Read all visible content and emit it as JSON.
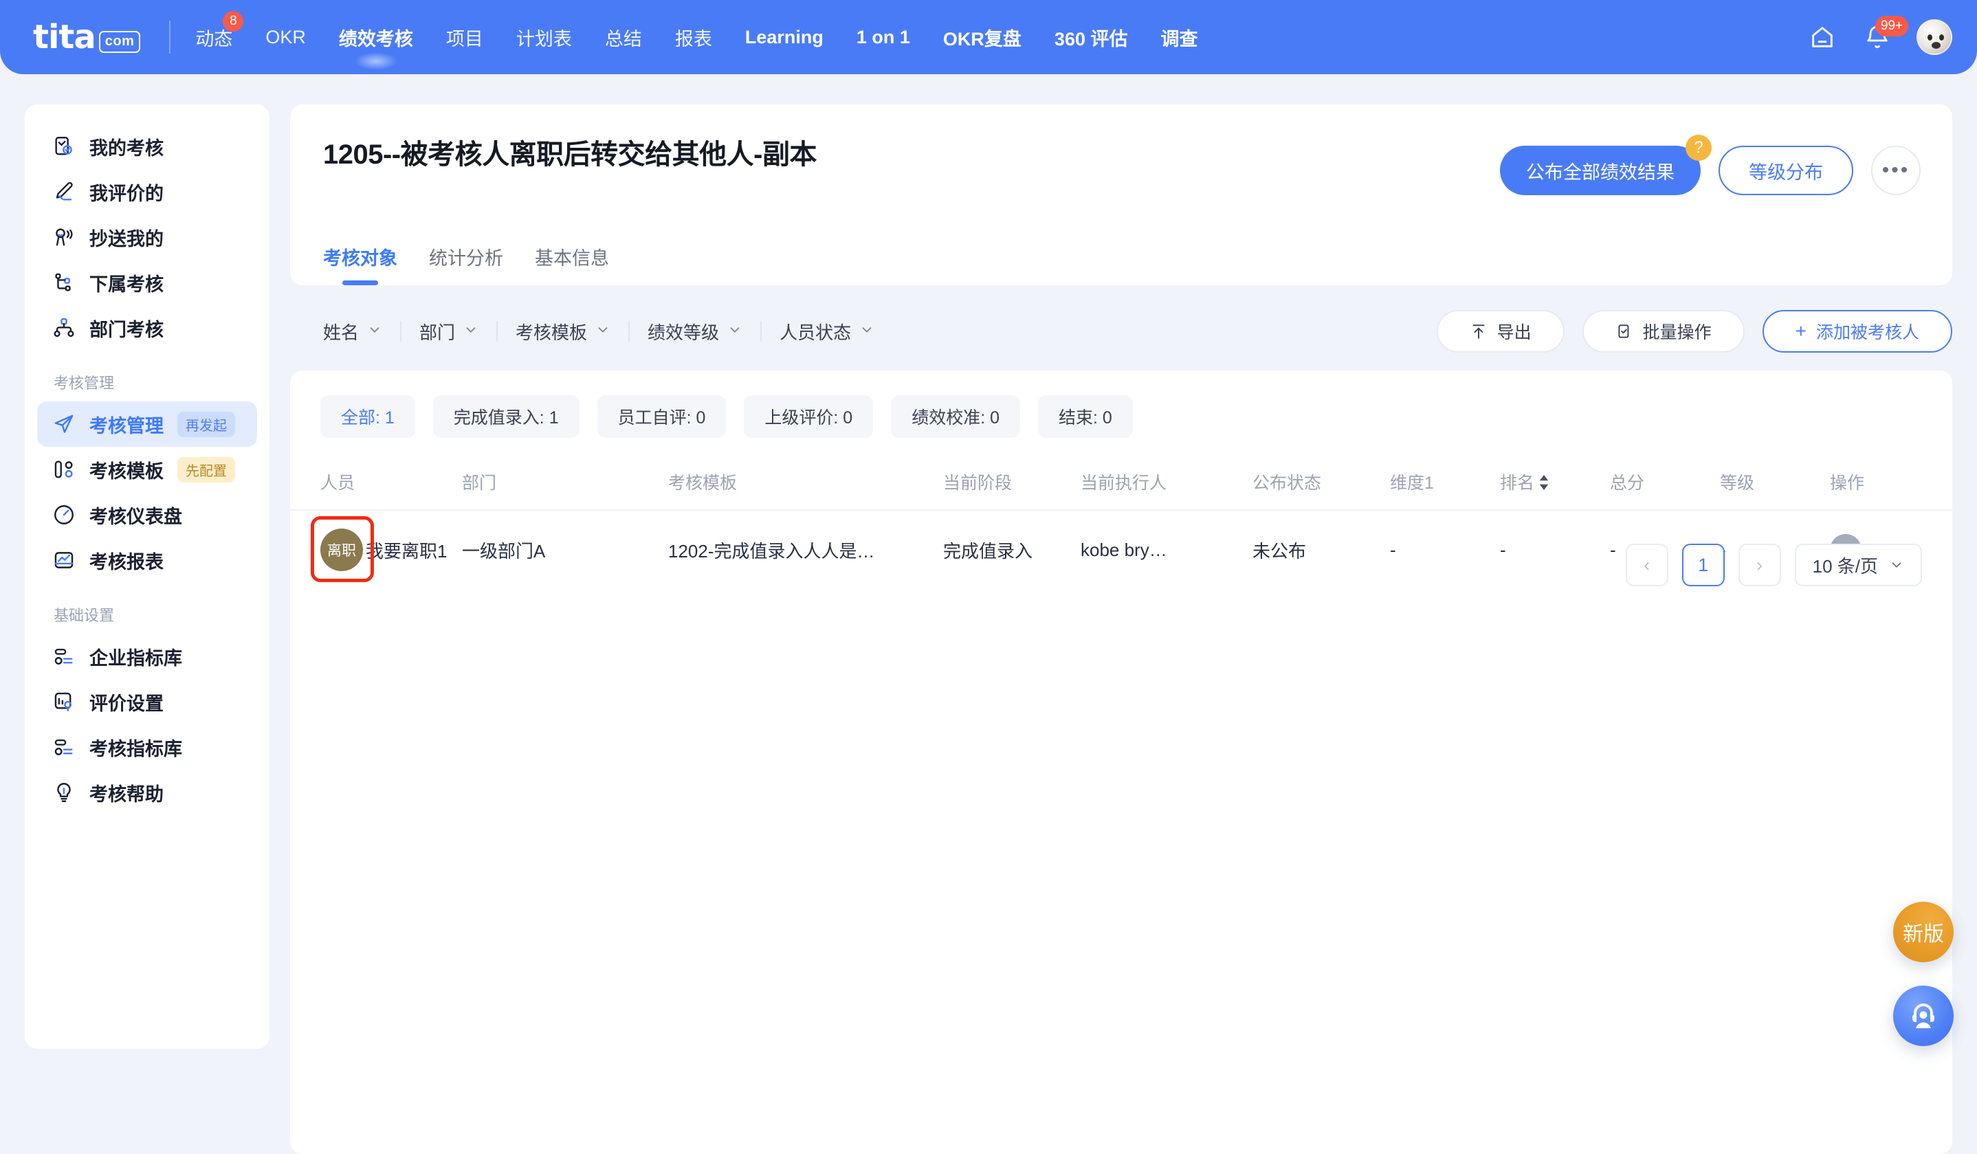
{
  "topnav": {
    "logo_main": "tita",
    "logo_suffix": ".com",
    "items": [
      {
        "label": "动态",
        "badge": "8",
        "active": false,
        "bold": false
      },
      {
        "label": "OKR",
        "badge": "",
        "active": false,
        "bold": false
      },
      {
        "label": "绩效考核",
        "badge": "",
        "active": true,
        "bold": true
      },
      {
        "label": "项目",
        "badge": "",
        "active": false,
        "bold": false
      },
      {
        "label": "计划表",
        "badge": "",
        "active": false,
        "bold": false
      },
      {
        "label": "总结",
        "badge": "",
        "active": false,
        "bold": false
      },
      {
        "label": "报表",
        "badge": "",
        "active": false,
        "bold": false
      },
      {
        "label": "Learning",
        "badge": "",
        "active": false,
        "bold": true
      },
      {
        "label": "1 on 1",
        "badge": "",
        "active": false,
        "bold": true
      },
      {
        "label": "OKR复盘",
        "badge": "",
        "active": false,
        "bold": true
      },
      {
        "label": "360 评估",
        "badge": "",
        "active": false,
        "bold": true
      },
      {
        "label": "调查",
        "badge": "",
        "active": false,
        "bold": true
      }
    ],
    "home_icon": "home-icon",
    "bell_icon": "bell-icon",
    "bell_badge": "99+",
    "avatar": "user-avatar"
  },
  "sidebar": {
    "items": [
      {
        "label": "我的考核",
        "icon": "my-review-icon",
        "tag": "",
        "active": false
      },
      {
        "label": "我评价的",
        "icon": "pencil-icon",
        "tag": "",
        "active": false
      },
      {
        "label": "抄送我的",
        "icon": "people-cc-icon",
        "tag": "",
        "active": false
      },
      {
        "label": "下属考核",
        "icon": "org-branch-icon",
        "tag": "",
        "active": false
      },
      {
        "label": "部门考核",
        "icon": "org-tree-icon",
        "tag": "",
        "active": false
      }
    ],
    "section_manage": "考核管理",
    "manage_items": [
      {
        "label": "考核管理",
        "icon": "paper-plane-icon",
        "tag": "再发起",
        "tag_style": "blue",
        "active": true
      },
      {
        "label": "考核模板",
        "icon": "template-icon",
        "tag": "先配置",
        "tag_style": "amber",
        "active": false
      },
      {
        "label": "考核仪表盘",
        "icon": "gauge-icon",
        "tag": "",
        "tag_style": "",
        "active": false
      },
      {
        "label": "考核报表",
        "icon": "chart-report-icon",
        "tag": "",
        "tag_style": "",
        "active": false
      }
    ],
    "section_basic": "基础设置",
    "basic_items": [
      {
        "label": "企业指标库",
        "icon": "list-box-icon",
        "tag": "",
        "active": false
      },
      {
        "label": "评价设置",
        "icon": "bar-settings-icon",
        "tag": "",
        "active": false
      },
      {
        "label": "考核指标库",
        "icon": "list-box-icon",
        "tag": "",
        "active": false
      },
      {
        "label": "考核帮助",
        "icon": "bulb-icon",
        "tag": "",
        "active": false
      }
    ]
  },
  "header": {
    "title": "1205--被考核人离职后转交给其他人-副本",
    "publish_button": "公布全部绩效结果",
    "publish_help_badge": "?",
    "grade_distribution_button": "等级分布",
    "more_button": "•••",
    "tabs": [
      {
        "label": "考核对象",
        "active": true
      },
      {
        "label": "统计分析",
        "active": false
      },
      {
        "label": "基本信息",
        "active": false
      }
    ]
  },
  "filters": [
    {
      "label": "姓名",
      "icon": "chevron-down-icon"
    },
    {
      "label": "部门",
      "icon": "chevron-down-icon"
    },
    {
      "label": "考核模板",
      "icon": "chevron-down-icon"
    },
    {
      "label": "绩效等级",
      "icon": "chevron-down-icon"
    },
    {
      "label": "人员状态",
      "icon": "chevron-down-icon"
    }
  ],
  "filter_actions": {
    "export": "导出",
    "export_icon": "export-icon",
    "batch": "批量操作",
    "batch_icon": "batch-icon",
    "add": "添加被考核人",
    "add_icon": "plus-icon"
  },
  "chips": [
    {
      "label": "全部: 1",
      "active": true
    },
    {
      "label": "完成值录入: 1",
      "active": false
    },
    {
      "label": "员工自评: 0",
      "active": false
    },
    {
      "label": "上级评价: 0",
      "active": false
    },
    {
      "label": "绩效校准: 0",
      "active": false
    },
    {
      "label": "结束: 0",
      "active": false
    }
  ],
  "table": {
    "columns": [
      "人员",
      "部门",
      "考核模板",
      "当前阶段",
      "当前执行人",
      "公布状态",
      "维度1",
      "排名",
      "总分",
      "等级",
      "操作"
    ],
    "sortable_column": "排名",
    "rows": [
      {
        "avatar_text": "离职",
        "avatar_color": "#8a7a4e",
        "highlighted": true,
        "name": "我要离职1",
        "department": "一级部门A",
        "template": "1202-完成值录入人人是…",
        "stage": "完成值录入",
        "executor": "kobe bry…",
        "publish_status": "未公布",
        "dimension1": "-",
        "rank": "-",
        "total": "-",
        "grade": "-",
        "action_icon": "more-dots-icon"
      }
    ]
  },
  "pagination": {
    "prev": "‹",
    "current_page": "1",
    "next": "›",
    "page_size": "10 条/页",
    "page_size_icon": "chevron-down-icon"
  },
  "floating": {
    "new_version": "新版",
    "support_icon": "headset-support-icon"
  },
  "colors": {
    "brand_blue": "#4a7bf7",
    "accent_blue": "#3d7afd",
    "badge_red": "#fa5a47",
    "amber": "#f5b73d",
    "highlight_red": "#ef2d16",
    "avatar_brown": "#8a7a4e"
  }
}
